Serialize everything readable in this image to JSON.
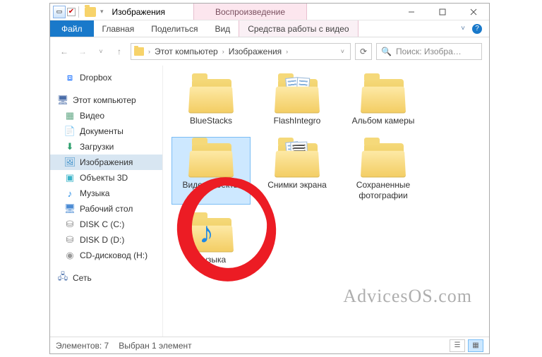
{
  "titlebar": {
    "title": "Изображения",
    "context_tab": "Воспроизведение"
  },
  "ribbon": {
    "file": "Файл",
    "home": "Главная",
    "share": "Поделиться",
    "view": "Вид",
    "context": "Средства работы с видео"
  },
  "address": {
    "crumb1": "Этот компьютер",
    "crumb2": "Изображения"
  },
  "search": {
    "placeholder": "Поиск: Изобра…"
  },
  "nav": {
    "dropbox": "Dropbox",
    "this_pc": "Этот компьютер",
    "videos": "Видео",
    "documents": "Документы",
    "downloads": "Загрузки",
    "pictures": "Изображения",
    "objects3d": "Объекты 3D",
    "music": "Музыка",
    "desktop": "Рабочий стол ",
    "disk_c": "DISK C (C:)",
    "disk_d": "DISK D (D:)",
    "cd_drive": "CD-дисковод (H:)",
    "network": "Сеть"
  },
  "items": {
    "bluestacks": "BlueStacks",
    "flashintegro": "FlashIntegro",
    "camera_album": "Альбом камеры",
    "video_projects": "Видеопроекты",
    "screenshots": "Снимки экрана",
    "saved_photos": "Сохраненные фотографии",
    "music": "Музыка"
  },
  "status": {
    "count": "Элементов: 7",
    "selected": "Выбран 1 элемент"
  },
  "watermark": "AdvicesOS.com"
}
